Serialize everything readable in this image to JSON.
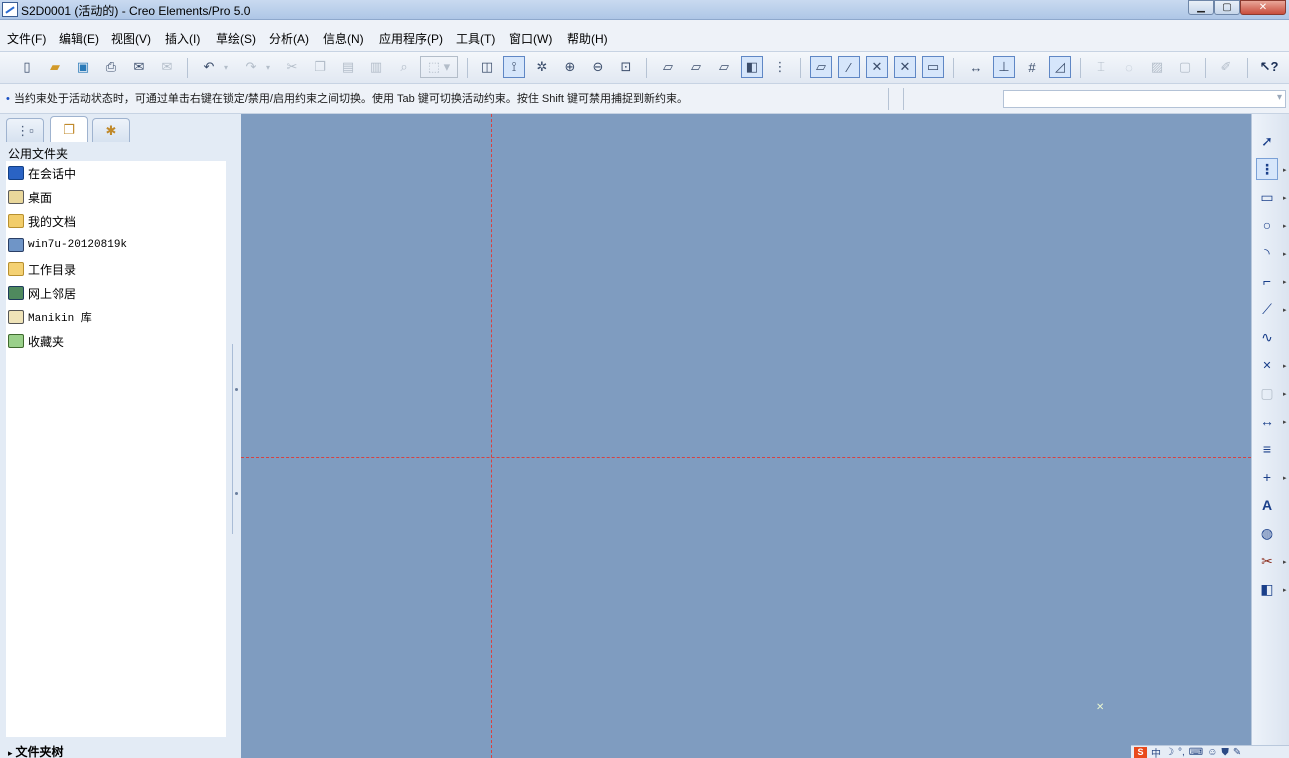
{
  "window": {
    "title": "S2D0001 (活动的) - Creo Elements/Pro 5.0",
    "min_label": "▁",
    "max_label": "▢",
    "close_label": "✕"
  },
  "menu": {
    "items": [
      "文件(F)",
      "编辑(E)",
      "视图(V)",
      "插入(I)",
      "草绘(S)",
      "分析(A)",
      "信息(N)",
      "应用程序(P)",
      "工具(T)",
      "窗口(W)",
      "帮助(H)"
    ]
  },
  "message": {
    "text": "当约束处于活动状态时，可通过单击右键在锁定/禁用/启用约束之间切换。使用 Tab 键可切换活动约束。按住 Shift 键可禁用捕捉到新约束。"
  },
  "navigator": {
    "panel_title": "公用文件夹",
    "items": [
      {
        "label": "在会话中",
        "icon": "session-icon",
        "mono": false
      },
      {
        "label": "桌面",
        "icon": "desktop-icon",
        "mono": false
      },
      {
        "label": "我的文档",
        "icon": "my-documents-icon",
        "mono": false
      },
      {
        "label": "win7u-20120819k",
        "icon": "computer-icon",
        "mono": true
      },
      {
        "label": "工作目录",
        "icon": "working-directory-icon",
        "mono": false
      },
      {
        "label": "网上邻居",
        "icon": "network-icon",
        "mono": false
      },
      {
        "label": "Manikin 库",
        "icon": "manikin-library-icon",
        "mono": true
      },
      {
        "label": "收藏夹",
        "icon": "favorites-icon",
        "mono": false
      }
    ],
    "footer": "文件夹树"
  },
  "tray": {
    "ime": "S",
    "lang": "中"
  },
  "colors": {
    "canvas_bg": "#7f9cc0",
    "centerline": "#d64242"
  }
}
